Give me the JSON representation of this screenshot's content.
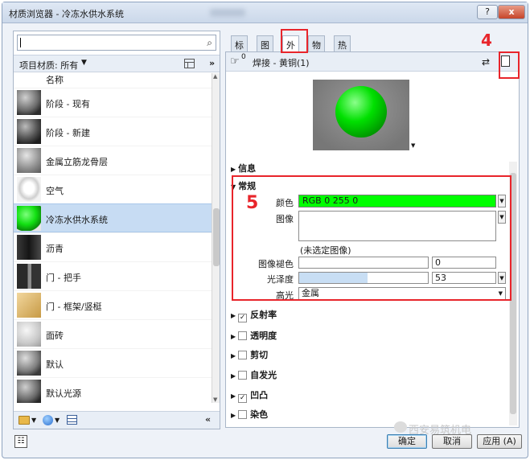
{
  "window": {
    "title": "材质浏览器 - 冷冻水供水系统",
    "help_label": "?",
    "close_label": "x"
  },
  "left_panel": {
    "search_placeholder": "",
    "filter_label": "项目材质: 所有",
    "filter_arrow": "▼",
    "expand_label": "»",
    "column_header": "名称",
    "materials": [
      {
        "label": "阶段 - 现有",
        "thumb": "grey-sphere"
      },
      {
        "label": "阶段 - 新建",
        "thumb": "dark-sphere"
      },
      {
        "label": "金属立筋龙骨层",
        "thumb": "metal-sphere"
      },
      {
        "label": "空气",
        "thumb": "air"
      },
      {
        "label": "冷冻水供水系统",
        "thumb": "green-sphere",
        "selected": true
      },
      {
        "label": "沥青",
        "thumb": "asphalt"
      },
      {
        "label": "门 - 把手",
        "thumb": "handle"
      },
      {
        "label": "门 - 框架/竖梃",
        "thumb": "wood-cube"
      },
      {
        "label": "面砖",
        "thumb": "tile-cube"
      },
      {
        "label": "默认",
        "thumb": "default-sphere"
      },
      {
        "label": "默认光源",
        "thumb": "light-sphere"
      }
    ],
    "collapse_label": "«"
  },
  "tabs": [
    {
      "label": "标识",
      "active": false
    },
    {
      "label": "图形",
      "active": false
    },
    {
      "label": "外观",
      "active": true
    },
    {
      "label": "物理",
      "active": false
    },
    {
      "label": "热度",
      "active": false
    }
  ],
  "asset": {
    "usage_count": "0",
    "name": "焊接 - 黄铜(1)"
  },
  "sections": {
    "info": "信息",
    "general": "常规",
    "reflectivity": "反射率",
    "transparency": "透明度",
    "cutout": "剪切",
    "self_illumination": "自发光",
    "bump": "凹凸",
    "tint": "染色"
  },
  "properties": {
    "color_label": "颜色",
    "color_value": "RGB 0 255 0",
    "image_label": "图像",
    "no_image": "(未选定图像)",
    "image_fade_label": "图像褪色",
    "image_fade_value": "0",
    "glossiness_label": "光泽度",
    "glossiness_value": "53",
    "highlights_label": "高光",
    "highlights_value": "金属"
  },
  "checkbox_states": {
    "reflectivity": true,
    "transparency": false,
    "cutout": false,
    "self_illumination": false,
    "bump": true,
    "tint": false
  },
  "annotations": {
    "step4": "4",
    "step5": "5"
  },
  "buttons": {
    "ok": "确定",
    "cancel": "取消",
    "apply": "应用 (A)"
  },
  "watermark": "西安易筑机电",
  "colors": {
    "accent_red": "#e8252b",
    "color_swatch": "#00ff00",
    "selected_row": "#c7dcf3"
  }
}
